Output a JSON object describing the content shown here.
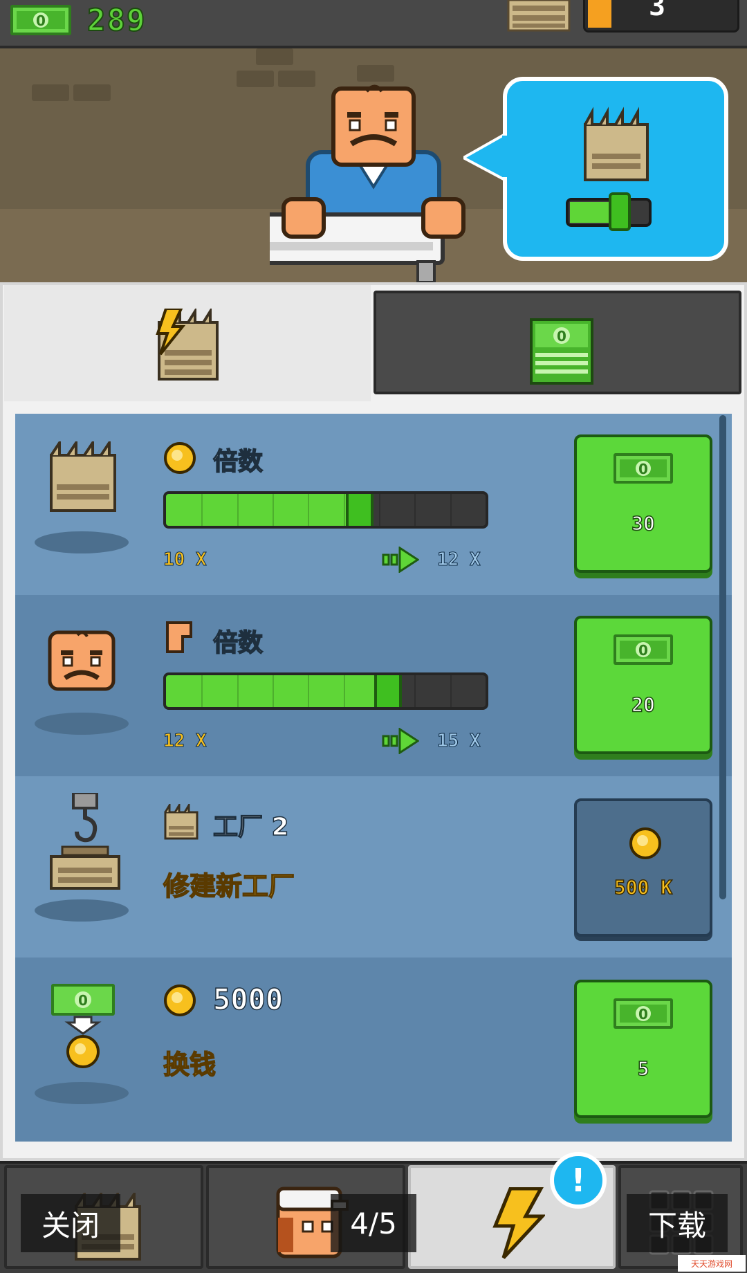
{
  "topbar": {
    "cash_amount": "289",
    "icons": [
      "cash-icon",
      "factory-icon"
    ],
    "level_value": "3"
  },
  "tabs": [
    {
      "name": "upgrades",
      "icon": "lightning-factory-icon",
      "active": true
    },
    {
      "name": "money",
      "icon": "cash-stack-icon",
      "active": false
    }
  ],
  "upgrades": [
    {
      "icon": "factory-icon",
      "title_icon": "gold-coin-icon",
      "title": "倍数",
      "progress": 0.64,
      "from": "10 X",
      "to": "12 X",
      "cost": "30",
      "cost_icon": "cash-icon"
    },
    {
      "icon": "worker-face-icon",
      "title_icon": "arm-icon",
      "title": "倍数",
      "progress": 0.73,
      "from": "12 X",
      "to": "15 X",
      "cost": "20",
      "cost_icon": "cash-icon"
    },
    {
      "icon": "crane-icon",
      "title_icon": "factory-icon",
      "title": "工厂 2",
      "subtitle": "修建新工厂",
      "cost": "500 K",
      "cost_icon": "gold-coin-icon",
      "locked": true
    },
    {
      "icon": "cash-to-coin-icon",
      "title_icon": "gold-coin-icon",
      "title": "5000",
      "subtitle": "换钱",
      "cost": "5",
      "cost_icon": "cash-icon"
    }
  ],
  "bottom_nav": [
    {
      "icon": "factory-icon"
    },
    {
      "icon": "worker-icon"
    },
    {
      "icon": "lightning-icon",
      "active": true,
      "badge": "!"
    },
    {
      "icon": "grid-icon"
    }
  ],
  "overlay": {
    "close_label": "关闭",
    "page_indicator": "4/5",
    "download_label": "下载"
  },
  "watermark": "天天游戏网"
}
